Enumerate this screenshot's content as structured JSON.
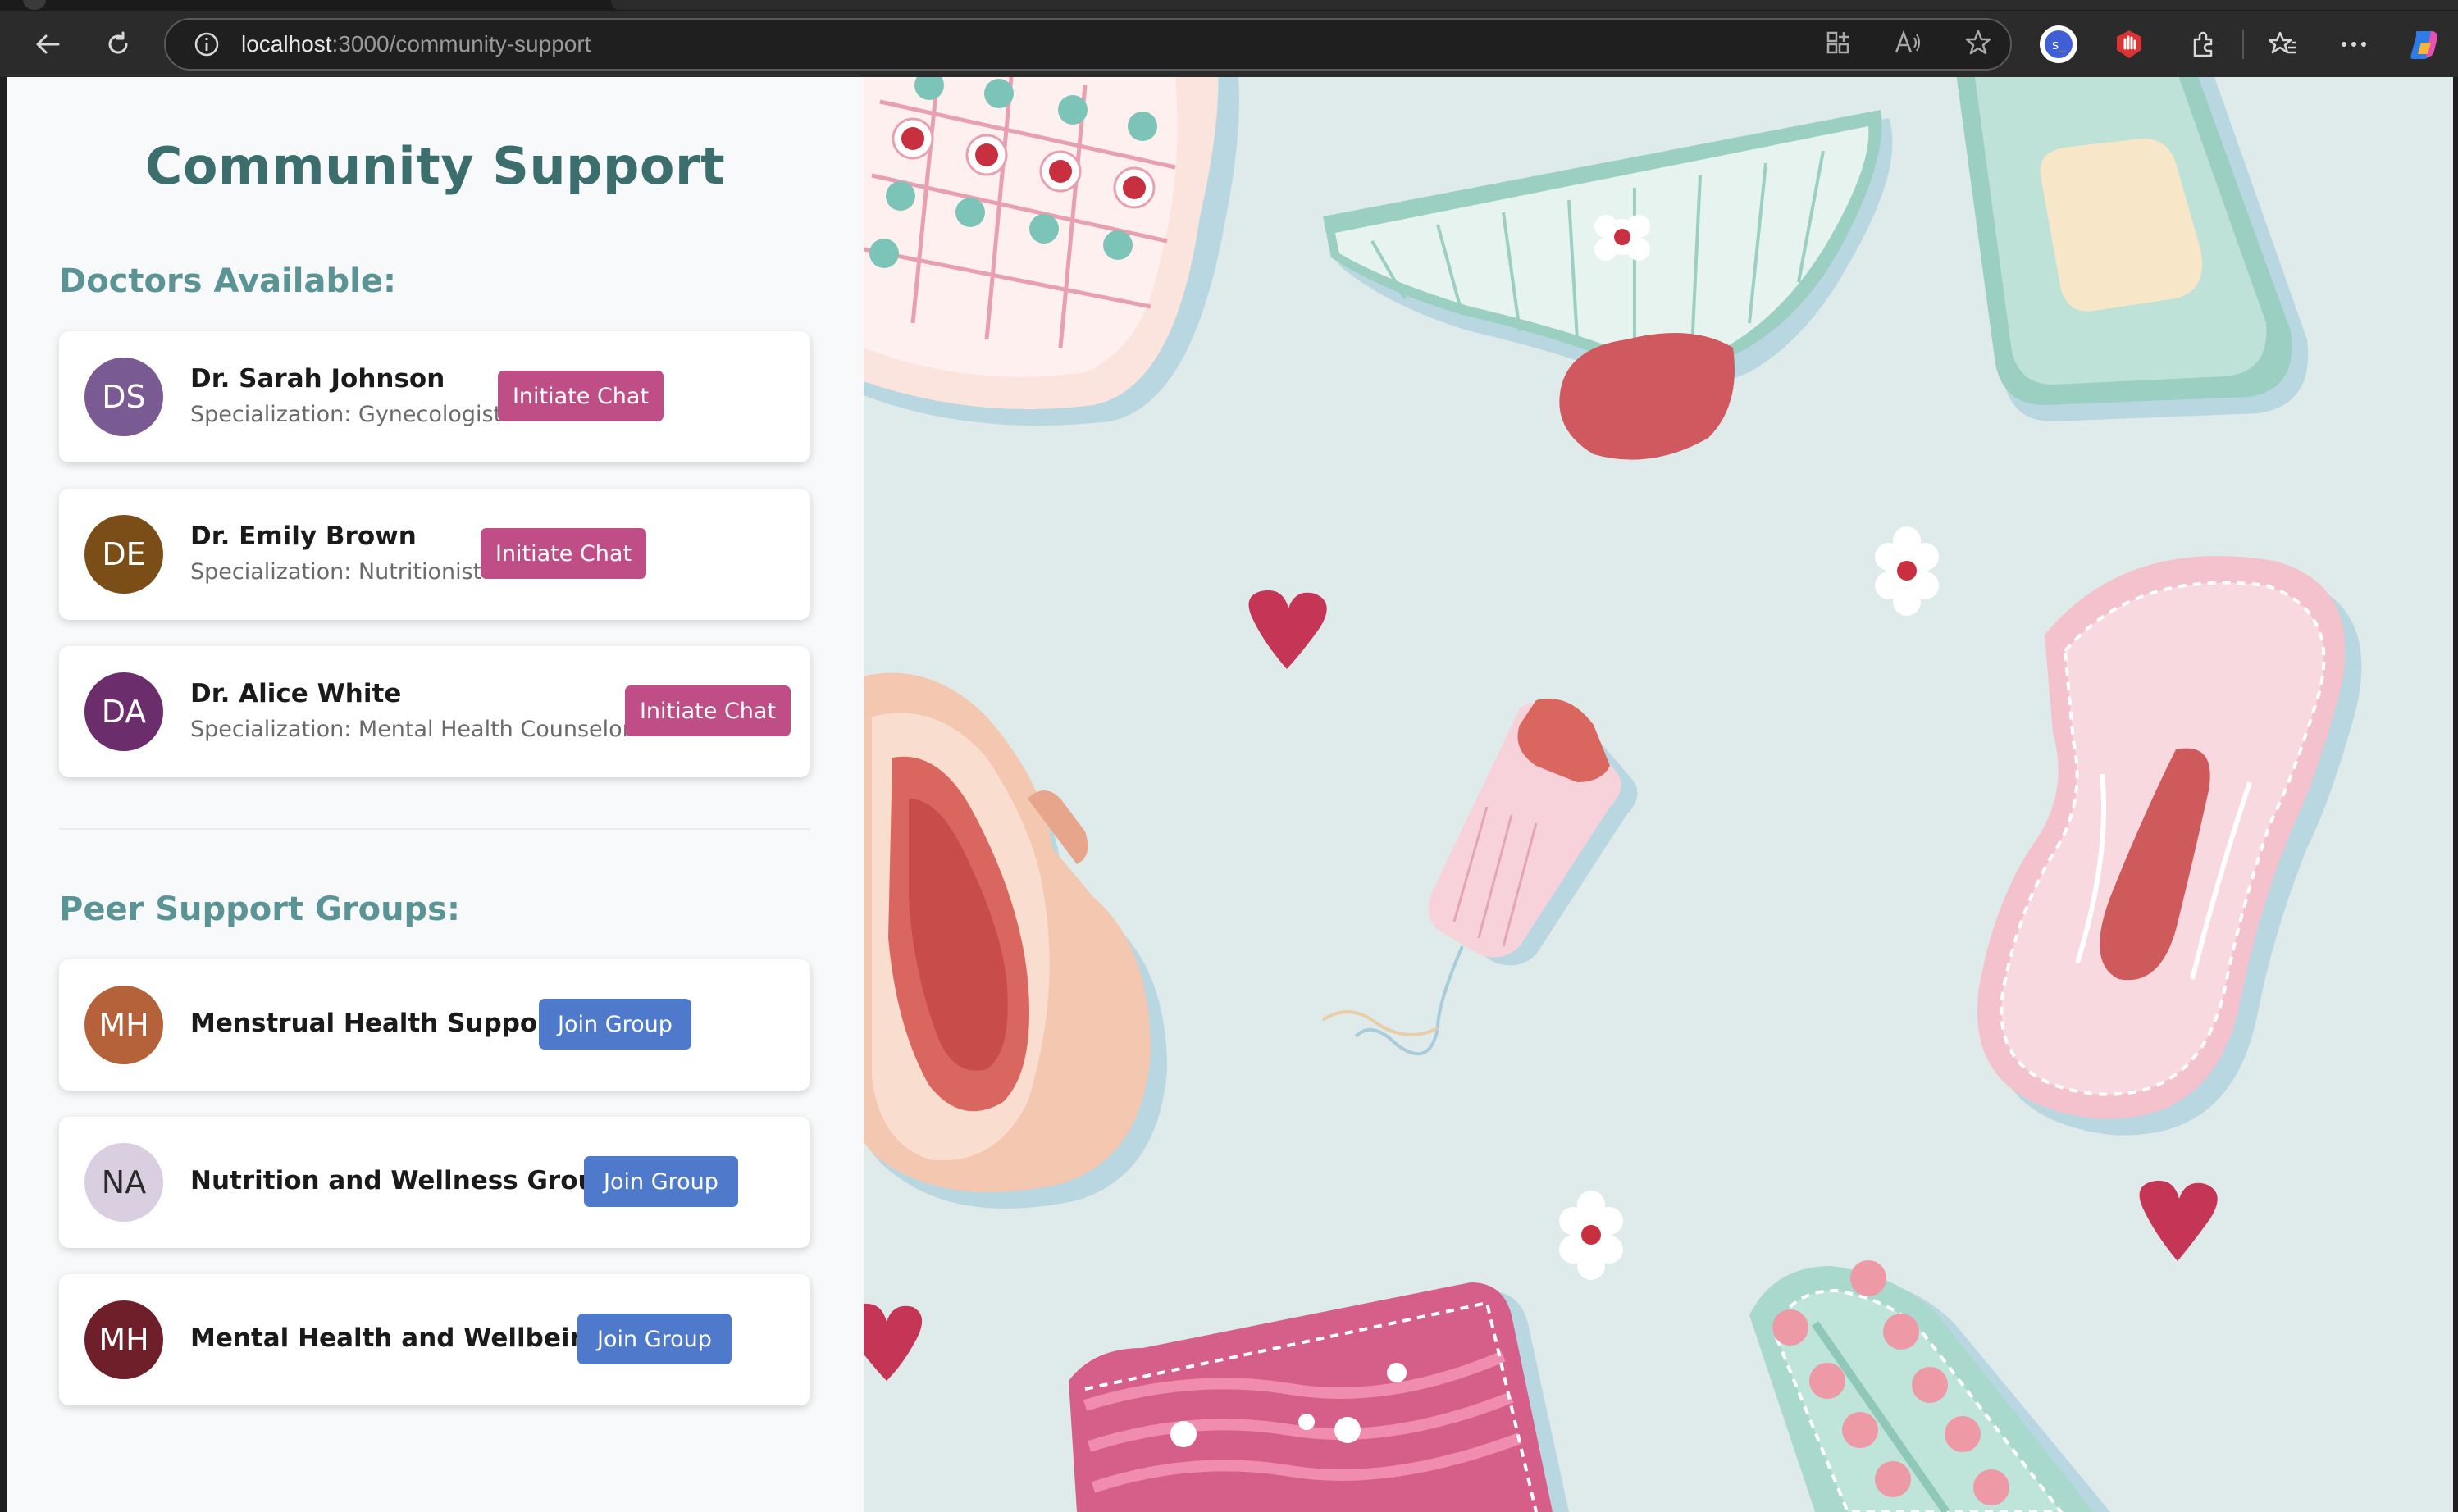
{
  "browser": {
    "url_host": "localhost",
    "url_path": ":3000/community-support"
  },
  "page": {
    "title": "Community Support",
    "doctors_heading": "Doctors Available:",
    "groups_heading": "Peer Support Groups:"
  },
  "doctors": [
    {
      "initials": "DS",
      "name": "Dr. Sarah Johnson",
      "specialization": "Specialization: Gynecologist",
      "button": "Initiate Chat",
      "avatar_color": "#7a5a93"
    },
    {
      "initials": "DE",
      "name": "Dr. Emily Brown",
      "specialization": "Specialization: Nutritionist",
      "button": "Initiate Chat",
      "avatar_color": "#7a4e16"
    },
    {
      "initials": "DA",
      "name": "Dr. Alice White",
      "specialization": "Specialization: Mental Health Counselor",
      "button": "Initiate Chat",
      "avatar_color": "#6b2d6b"
    }
  ],
  "groups": [
    {
      "initials": "MH",
      "name": "Menstrual Health Support",
      "button": "Join Group",
      "avatar_color": "#b5623a",
      "initials_color": "#ffffff"
    },
    {
      "initials": "NA",
      "name": "Nutrition and Wellness Group",
      "button": "Join Group",
      "avatar_color": "#d9cfe0",
      "initials_color": "#2b2b2b"
    },
    {
      "initials": "MH",
      "name": "Mental Health and Wellbeing",
      "button": "Join Group",
      "avatar_color": "#6e1f2a",
      "initials_color": "#ffffff"
    }
  ],
  "colors": {
    "title": "#3d6e6e",
    "section": "#5a9494",
    "chat_button": "#c04e86",
    "join_button": "#4f7acb",
    "background_art": "#dfeaea"
  },
  "icons": [
    "back-icon",
    "refresh-icon",
    "info-icon",
    "apps-icon",
    "read-aloud-icon",
    "favorite-star-icon",
    "profile-icon",
    "extension-red-icon",
    "extensions-icon",
    "favorites-icon",
    "more-icon",
    "copilot-icon"
  ]
}
